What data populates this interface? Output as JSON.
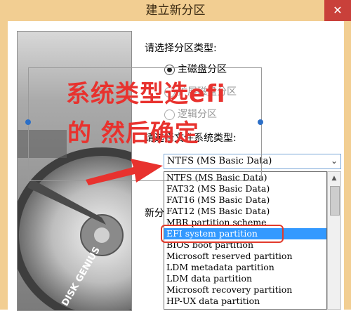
{
  "window": {
    "title": "建立新分区",
    "close_glyph": "✕"
  },
  "partition_type": {
    "prompt": "请选择分区类型:",
    "options": [
      {
        "label": "主磁盘分区",
        "selected": true,
        "enabled": true
      },
      {
        "label": "扩展磁盘分区",
        "selected": false,
        "enabled": false
      },
      {
        "label": "逻辑分区",
        "selected": false,
        "enabled": false
      }
    ]
  },
  "filesystem": {
    "prompt": "请选择文件系统类型:",
    "current_value": "NTFS (MS Basic Data)",
    "options": [
      "NTFS (MS Basic Data)",
      "FAT32 (MS Basic Data)",
      "FAT16 (MS Basic Data)",
      "FAT12 (MS Basic Data)",
      "MBR partition scheme",
      "EFI system partition",
      "BIOS boot partition",
      "Microsoft reserved partition",
      "LDM metadata partition",
      "LDM data partition",
      "Microsoft recovery partition",
      "HP-UX data partition"
    ],
    "highlighted_option": "EFI system partition"
  },
  "partial_label": "新分",
  "annotations": {
    "line1": "系统类型选efi",
    "line2": "的 然后确定",
    "color": "#e8322e"
  },
  "image_panel": {
    "brand": "DISK GENIUS"
  },
  "colors": {
    "titlebar": "#f2ce92",
    "selection": "#3399ff",
    "close": "#c9403a"
  }
}
